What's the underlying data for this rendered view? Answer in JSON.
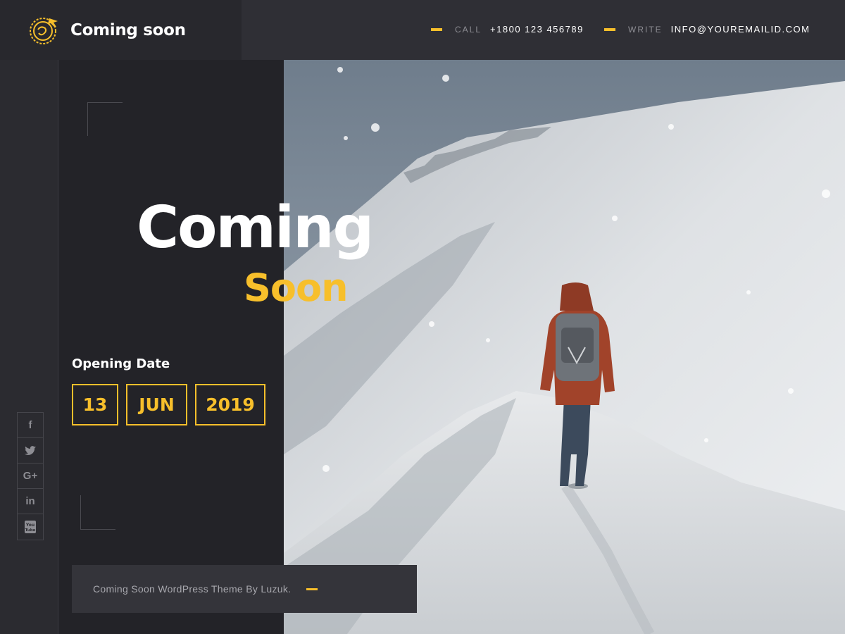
{
  "header": {
    "brand_title": "Coming soon",
    "call_label": "CALL",
    "call_value": "+1800 123 456789",
    "write_label": "WRITE",
    "write_value": "INFO@YOUREMAILID.COM"
  },
  "hero": {
    "line1": "Coming",
    "line2": "Soon"
  },
  "opening": {
    "label": "Opening Date",
    "day": "13",
    "month": "JUN",
    "year": "2019"
  },
  "social": {
    "items": [
      {
        "icon": "facebook-icon",
        "glyph": "f"
      },
      {
        "icon": "twitter-icon",
        "glyph": "🐦︎"
      },
      {
        "icon": "google-plus-icon",
        "glyph": "G+"
      },
      {
        "icon": "linkedin-icon",
        "glyph": "in"
      },
      {
        "icon": "youtube-icon",
        "glyph": "▶"
      }
    ]
  },
  "footer": {
    "credit": "Coming Soon WordPress Theme By Luzuk."
  },
  "colors": {
    "accent": "#f7bf2b",
    "panel": "#232328",
    "header": "#2f2f35"
  }
}
